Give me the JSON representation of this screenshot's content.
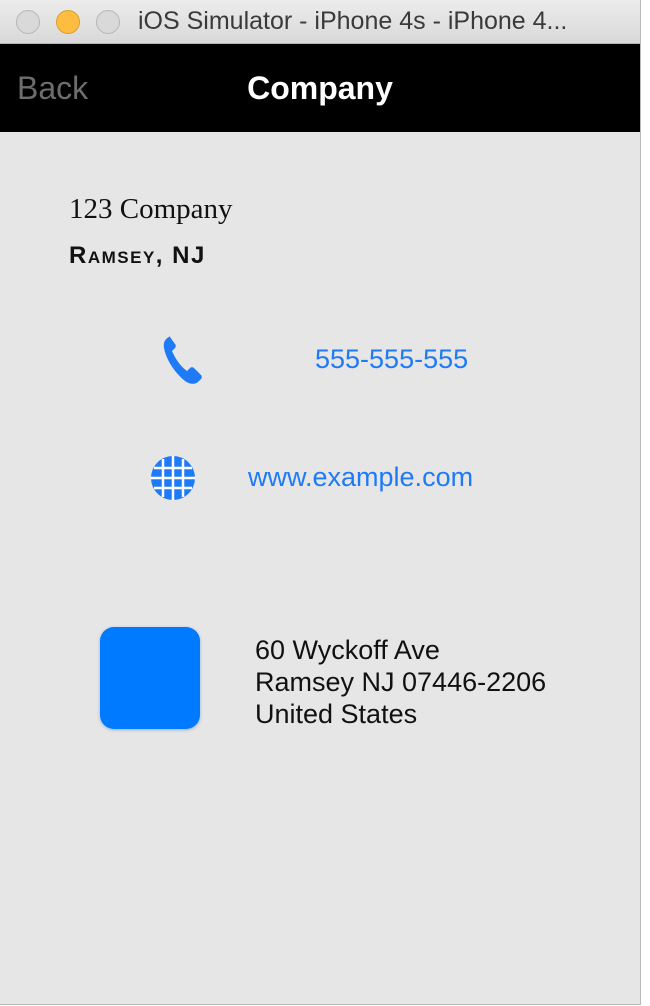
{
  "window": {
    "title": "iOS Simulator - iPhone 4s - iPhone 4..."
  },
  "navbar": {
    "back_label": "Back",
    "title": "Company"
  },
  "company": {
    "name": "123 Company",
    "city": "Ramsey, NJ"
  },
  "contact": {
    "phone": "555-555-555",
    "phone_icon": "phone-icon",
    "website": "www.example.com",
    "website_icon": "globe-icon"
  },
  "address": {
    "line1": "60 Wyckoff Ave",
    "line2": "Ramsey NJ 07446-2206",
    "line3": "United States"
  },
  "colors": {
    "accent": "#1e7bf5",
    "map_tile": "#007aff",
    "navbar_bg": "#000000",
    "content_bg": "#e6e6e6"
  }
}
